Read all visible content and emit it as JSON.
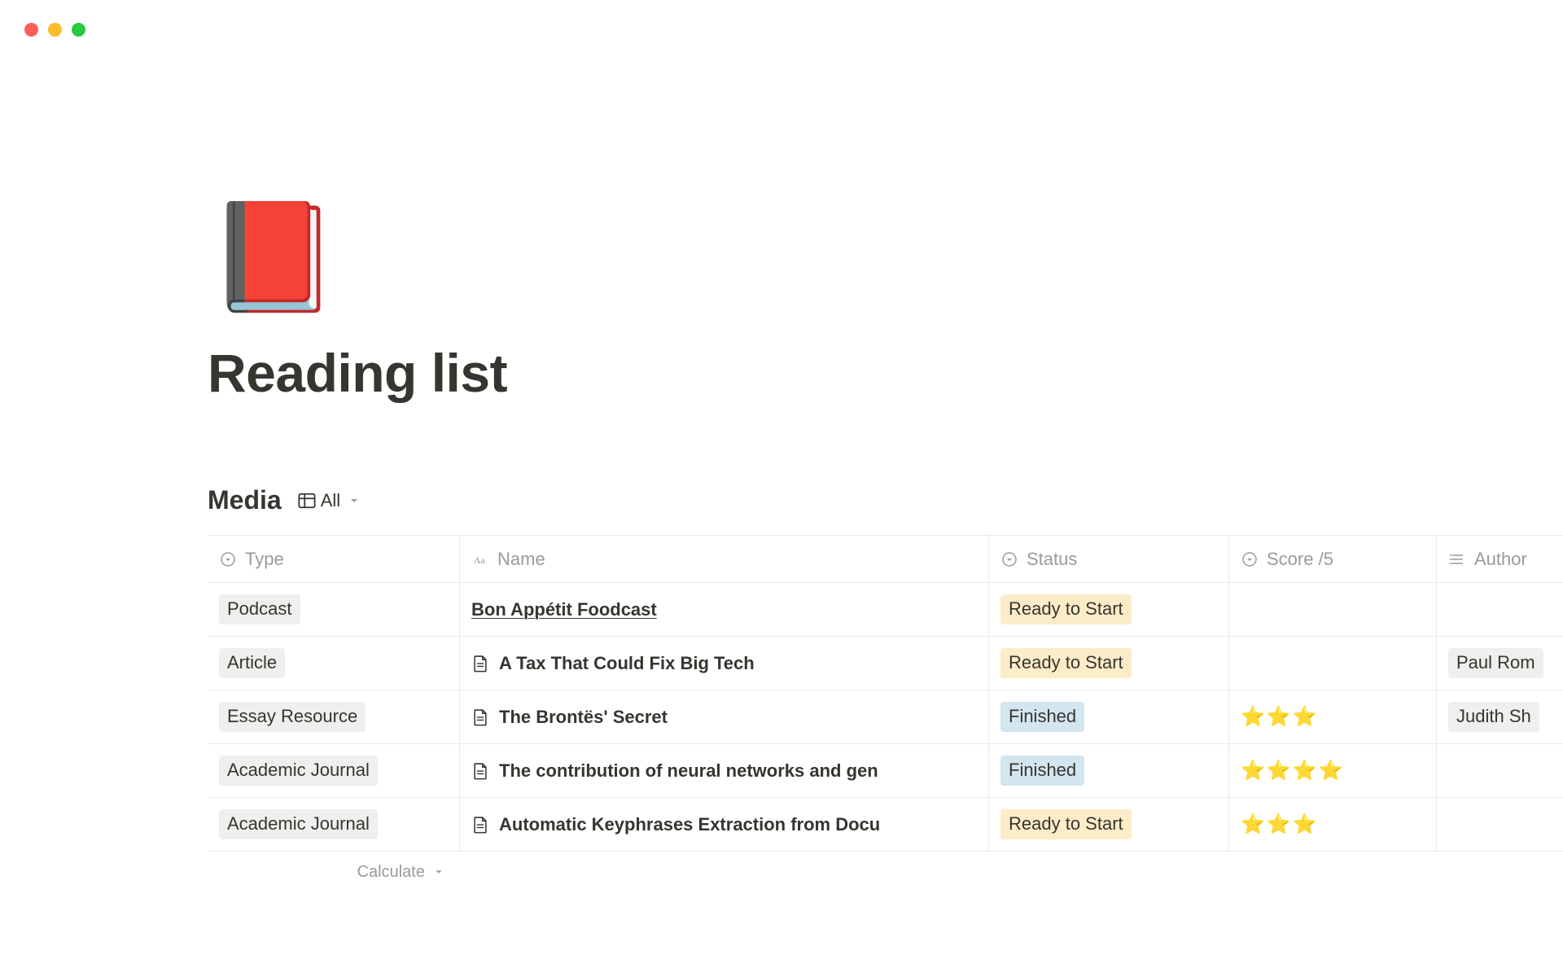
{
  "page": {
    "icon": "📕",
    "title": "Reading list"
  },
  "database": {
    "title": "Media",
    "view_label": "All",
    "calculate_label": "Calculate",
    "columns": {
      "type": "Type",
      "name": "Name",
      "status": "Status",
      "score": "Score /5",
      "author": "Author"
    },
    "rows": [
      {
        "type": {
          "label": "Podcast",
          "color": "gray"
        },
        "name": "Bon Appétit Foodcast",
        "has_page_icon": false,
        "underline_name": true,
        "status": {
          "label": "Ready to Start",
          "color": "yellow"
        },
        "score": "",
        "author": ""
      },
      {
        "type": {
          "label": "Article",
          "color": "gray"
        },
        "name": "A Tax That Could Fix Big Tech",
        "has_page_icon": true,
        "underline_name": false,
        "status": {
          "label": "Ready to Start",
          "color": "yellow"
        },
        "score": "",
        "author": "Paul Rom"
      },
      {
        "type": {
          "label": "Essay Resource",
          "color": "gray"
        },
        "name": "The Brontës' Secret",
        "has_page_icon": true,
        "underline_name": false,
        "status": {
          "label": "Finished",
          "color": "blue"
        },
        "score": "⭐⭐⭐",
        "author": "Judith Sh"
      },
      {
        "type": {
          "label": "Academic Journal",
          "color": "gray"
        },
        "name": "The contribution of neural networks and gen",
        "has_page_icon": true,
        "underline_name": false,
        "status": {
          "label": "Finished",
          "color": "blue"
        },
        "score": "⭐⭐⭐⭐",
        "author": ""
      },
      {
        "type": {
          "label": "Academic Journal",
          "color": "gray"
        },
        "name": "Automatic Keyphrases Extraction from Docu",
        "has_page_icon": true,
        "underline_name": false,
        "status": {
          "label": "Ready to Start",
          "color": "yellow"
        },
        "score": "⭐⭐⭐",
        "author": ""
      }
    ]
  }
}
